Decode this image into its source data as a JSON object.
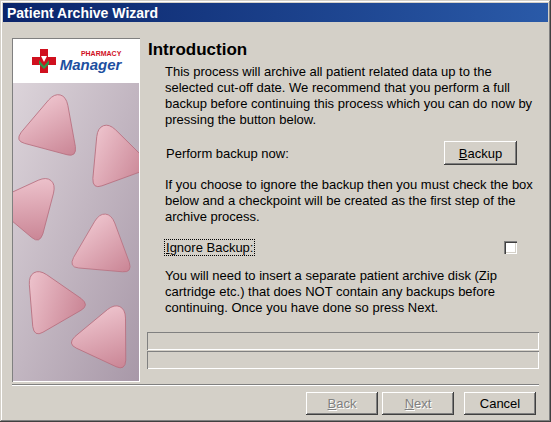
{
  "window": {
    "title": "Patient Archive Wizard"
  },
  "logo": {
    "small": "PHARMACY",
    "large": "Manager"
  },
  "page": {
    "heading": "Introduction"
  },
  "content": [
    {
      "kind": "paragraph",
      "text": "This process will archive all patient related data up to the selected cut-off date. We recommend that you perform a full backup before continuing this process which you can do now by pressing the button below."
    },
    {
      "kind": "action",
      "label": "Perform backup now:",
      "button": {
        "label": "Backup",
        "underline": 0
      }
    },
    {
      "kind": "paragraph",
      "text": "If you choose to ignore the backup then you must check the box below and a checkpoint will be created as the first step of the archive process."
    },
    {
      "kind": "checkbox",
      "label": "Ignore Backup:",
      "underline": 0,
      "checked": false,
      "focused": true
    },
    {
      "kind": "paragraph",
      "text": "You will need to insert a separate patient archive disk (Zip cartridge etc.) that does NOT contain any backups before continuing. Once you have done so press Next."
    }
  ],
  "progress": [
    {
      "level": 0
    },
    {
      "level": 0
    }
  ],
  "buttons": [
    {
      "label": "Back",
      "underline": 0,
      "disabled": true
    },
    {
      "label": "Next",
      "underline": 0,
      "disabled": true
    },
    {
      "label": "Cancel",
      "underline": -1,
      "disabled": false
    }
  ]
}
